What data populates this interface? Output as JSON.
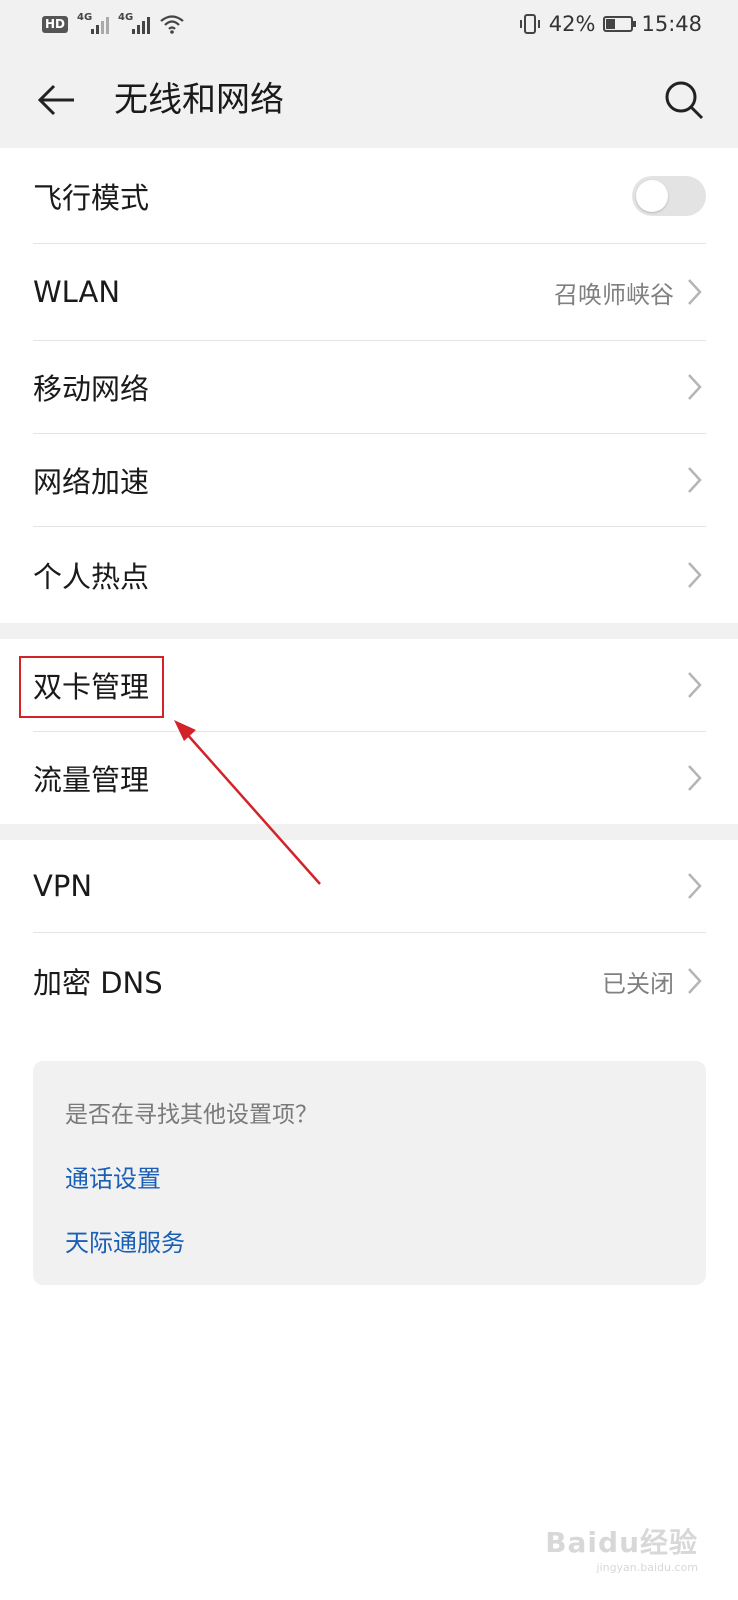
{
  "status_bar": {
    "hd_label": "HD",
    "sim1_tech": "4G",
    "sim2_tech": "4G",
    "battery_percent": "42%",
    "battery_level": 0.42,
    "time": "15:48"
  },
  "app_bar": {
    "title": "无线和网络",
    "back_icon": "arrow-left-icon",
    "search_icon": "search-icon"
  },
  "sections": [
    {
      "items": [
        {
          "label": "飞行模式",
          "control": "toggle",
          "toggle_on": false
        },
        {
          "label": "WLAN",
          "value": "召唤师峡谷",
          "control": "chevron"
        },
        {
          "label": "移动网络",
          "control": "chevron"
        },
        {
          "label": "网络加速",
          "control": "chevron"
        },
        {
          "label": "个人热点",
          "control": "chevron"
        }
      ]
    },
    {
      "items": [
        {
          "label": "双卡管理",
          "control": "chevron",
          "highlighted": true
        },
        {
          "label": "流量管理",
          "control": "chevron"
        }
      ]
    },
    {
      "items": [
        {
          "label": "VPN",
          "control": "chevron"
        },
        {
          "label": "加密 DNS",
          "value": "已关闭",
          "control": "chevron"
        }
      ]
    }
  ],
  "suggestions": {
    "question": "是否在寻找其他设置项？",
    "links": [
      "通话设置",
      "天际通服务"
    ]
  },
  "annotation": {
    "color": "#d2232a"
  },
  "watermark": {
    "text": "Baidu经验",
    "sub": "jingyan.baidu.com"
  },
  "colors": {
    "accent_link": "#1a5fb4",
    "bar_background": "#f1f1f1"
  }
}
